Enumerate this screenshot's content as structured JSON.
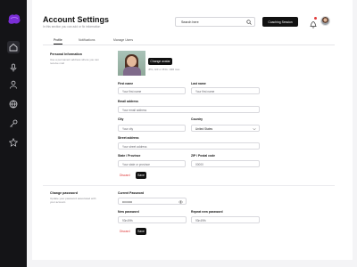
{
  "sidebar": {
    "logo": "logo-mark",
    "items": [
      {
        "icon": "home-icon",
        "active": true
      },
      {
        "icon": "microphone-icon"
      },
      {
        "icon": "user-icon"
      },
      {
        "icon": "globe-icon"
      },
      {
        "icon": "key-icon"
      },
      {
        "icon": "star-icon"
      }
    ]
  },
  "header": {
    "title": "Account Settings",
    "subtitle": "In this section you can add or fix information",
    "search": {
      "placeholder": "Search here"
    },
    "cta_label": "Coaching Session",
    "notification_icon": "bell-icon"
  },
  "tabs": [
    {
      "label": "Profile",
      "active": true
    },
    {
      "label": "Notifications"
    },
    {
      "label": "Manage Users"
    }
  ],
  "personal": {
    "heading": "Personal Information",
    "description": "Use a permanent address where you can receive mail",
    "change_avatar_label": "Change avatar",
    "avatar_hint": "JPG, GIF or PNG. 1MB max.",
    "first_name": {
      "label": "First name",
      "placeholder": "Your first name"
    },
    "last_name": {
      "label": "Last name",
      "placeholder": "Your first name"
    },
    "email": {
      "label": "Email address",
      "placeholder": "Your email address"
    },
    "city": {
      "label": "City",
      "placeholder": "Your city"
    },
    "country": {
      "label": "Country",
      "value": "United States"
    },
    "street": {
      "label": "Street address",
      "placeholder": "Your street address"
    },
    "state": {
      "label": "State / Province",
      "placeholder": "Your state or province"
    },
    "zip": {
      "label": "ZIP / Postal code",
      "value": "00000"
    },
    "discard_label": "Discard",
    "save_label": "Save"
  },
  "password": {
    "heading": "Change password",
    "description": "Update your password associated with your account.",
    "current": {
      "label": "Current Password",
      "value": "••••••••••"
    },
    "new": {
      "label": "New password",
      "value": "93n49fh"
    },
    "repeat": {
      "label": "Repeat new password",
      "value": "93n49fh"
    },
    "discard_label": "Discard",
    "save_label": "Save"
  },
  "colors": {
    "sidebar": "#141417",
    "accent": "#111111",
    "danger": "#dd3333",
    "logo": "#7a2ed6"
  }
}
